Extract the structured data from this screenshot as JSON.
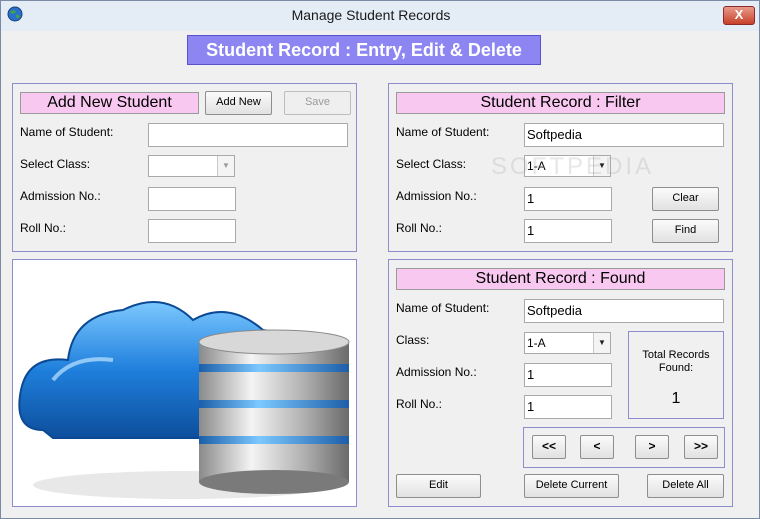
{
  "window": {
    "title": "Manage Student Records",
    "close_label": "X"
  },
  "heading": "Student Record : Entry, Edit & Delete",
  "add_panel": {
    "title": "Add New Student",
    "add_button": "Add New",
    "save_button": "Save",
    "name_label": "Name of Student:",
    "name_value": "",
    "class_label": "Select Class:",
    "class_value": "",
    "admission_label": "Admission No.:",
    "admission_value": "",
    "roll_label": "Roll No.:",
    "roll_value": ""
  },
  "filter_panel": {
    "title": "Student Record : Filter",
    "name_label": "Name of Student:",
    "name_value": "Softpedia",
    "class_label": "Select Class:",
    "class_value": "1-A",
    "admission_label": "Admission No.:",
    "admission_value": "1",
    "roll_label": "Roll No.:",
    "roll_value": "1",
    "clear_button": "Clear",
    "find_button": "Find"
  },
  "found_panel": {
    "title": "Student Record : Found",
    "name_label": "Name of Student:",
    "name_value": "Softpedia",
    "class_label": "Class:",
    "class_value": "1-A",
    "admission_label": "Admission No.:",
    "admission_value": "1",
    "roll_label": "Roll No.:",
    "roll_value": "1",
    "total_label": "Total Records Found:",
    "total_value": "1",
    "nav": {
      "first": "<<",
      "prev": "<",
      "next": ">",
      "last": ">>"
    },
    "edit_button": "Edit",
    "delete_current_button": "Delete Current",
    "delete_all_button": "Delete All"
  },
  "watermark": "SOFTPEDIA",
  "colors": {
    "heading_bg": "#8d86f2",
    "panel_title_bg": "#f9c8f0",
    "panel_border": "#8c8ccf"
  },
  "icons": {
    "app": "globe-icon",
    "dropdown": "dropdown-arrow-icon",
    "illustration": "cloud-database-icon"
  }
}
